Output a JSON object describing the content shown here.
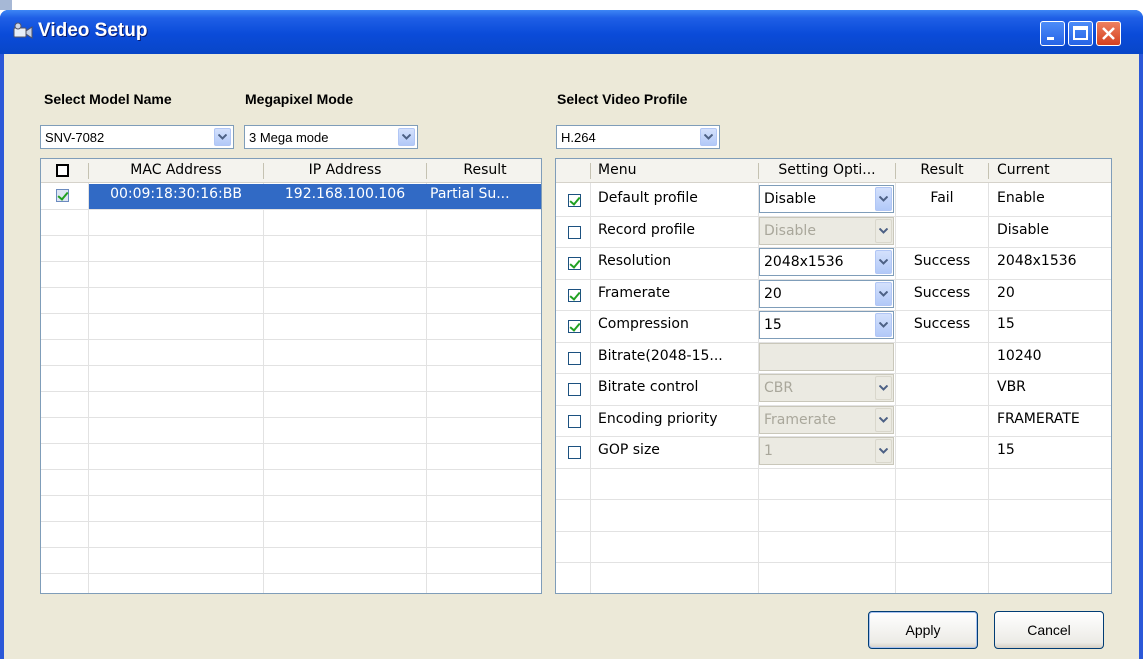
{
  "window": {
    "title": "Video Setup",
    "icon": "video-camera-icon"
  },
  "left": {
    "model_label": "Select Model Name",
    "model_value": "SNV-7082",
    "mega_label": "Megapixel Mode",
    "mega_value": "3 Mega mode",
    "columns": [
      "MAC Address",
      "IP Address",
      "Result"
    ],
    "rows": [
      {
        "checked": true,
        "mac": "00:09:18:30:16:BB",
        "ip": "192.168.100.106",
        "result": "Partial Su..."
      }
    ]
  },
  "right": {
    "profile_label": "Select Video Profile",
    "profile_value": "H.264",
    "columns": [
      "Menu",
      "Setting Opti...",
      "Result",
      "Current"
    ],
    "rows": [
      {
        "checked": true,
        "menu": "Default profile",
        "setting": "Disable",
        "enabled": true,
        "result": "Fail",
        "current": "Enable"
      },
      {
        "checked": false,
        "menu": "Record profile",
        "setting": "Disable",
        "enabled": false,
        "result": "",
        "current": "Disable"
      },
      {
        "checked": true,
        "menu": "Resolution",
        "setting": "2048x1536",
        "enabled": true,
        "result": "Success",
        "current": "2048x1536"
      },
      {
        "checked": true,
        "menu": "Framerate",
        "setting": "20",
        "enabled": true,
        "result": "Success",
        "current": "20"
      },
      {
        "checked": true,
        "menu": "Compression",
        "setting": "15",
        "enabled": true,
        "result": "Success",
        "current": "15"
      },
      {
        "checked": false,
        "menu": "Bitrate(2048-15...",
        "setting": "",
        "enabled": false,
        "result": "",
        "current": "10240",
        "no_arrow": true
      },
      {
        "checked": false,
        "menu": "Bitrate control",
        "setting": "CBR",
        "enabled": false,
        "result": "",
        "current": "VBR"
      },
      {
        "checked": false,
        "menu": "Encoding priority",
        "setting": "Framerate",
        "enabled": false,
        "result": "",
        "current": "FRAMERATE"
      },
      {
        "checked": false,
        "menu": "GOP size",
        "setting": "1",
        "enabled": false,
        "result": "",
        "current": "15"
      }
    ]
  },
  "buttons": {
    "apply": "Apply",
    "cancel": "Cancel"
  },
  "colors": {
    "titlebar": "#0a4bd9",
    "selection": "#316ac5",
    "dialog_bg": "#ece9d8"
  }
}
